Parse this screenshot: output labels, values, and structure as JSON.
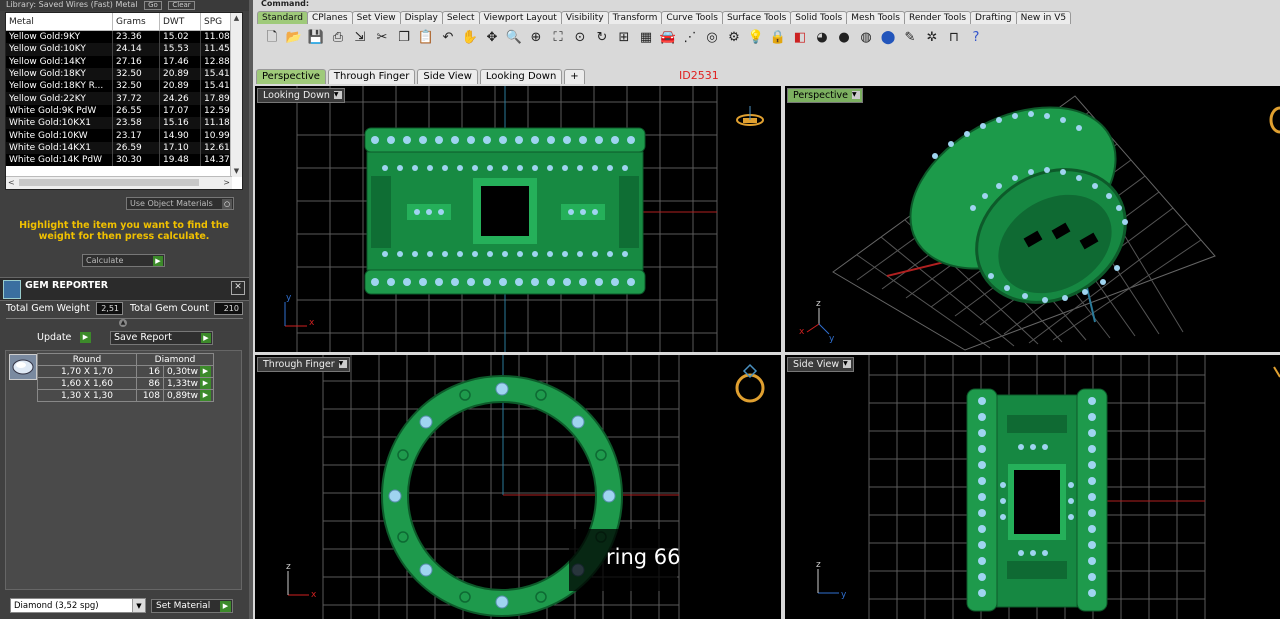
{
  "left_panel": {
    "top_strip": "Library: Saved Wires (Fast) Metal",
    "top_buttons": [
      "Go",
      "Clear"
    ],
    "metal_columns": [
      "Metal",
      "Grams",
      "DWT",
      "SPG"
    ],
    "metal_rows": [
      [
        "Yellow Gold:9KY",
        "23.36",
        "15.02",
        "11.08"
      ],
      [
        "Yellow Gold:10KY",
        "24.14",
        "15.53",
        "11.45"
      ],
      [
        "Yellow Gold:14KY",
        "27.16",
        "17.46",
        "12.88"
      ],
      [
        "Yellow Gold:18KY",
        "32.50",
        "20.89",
        "15.41"
      ],
      [
        "Yellow Gold:18KY R...",
        "32.50",
        "20.89",
        "15.41"
      ],
      [
        "Yellow Gold:22KY",
        "37.72",
        "24.26",
        "17.89"
      ],
      [
        "White Gold:9K PdW",
        "26.55",
        "17.07",
        "12.59"
      ],
      [
        "White Gold:10KX1",
        "23.58",
        "15.16",
        "11.18"
      ],
      [
        "White Gold:10KW",
        "23.17",
        "14.90",
        "10.99"
      ],
      [
        "White Gold:14KX1",
        "26.59",
        "17.10",
        "12.61"
      ],
      [
        "White Gold:14K PdW",
        "30.30",
        "19.48",
        "14.37"
      ]
    ],
    "use_object_materials": "Use Object Materials",
    "hint": "Highlight the item you want to find the weight for then press calculate.",
    "calculate_label": "Calculate"
  },
  "gem_reporter": {
    "title": "GEM REPORTER",
    "total_gem_weight_label": "Total Gem Weight",
    "total_gem_weight": "2,51",
    "total_gem_count_label": "Total Gem Count",
    "total_gem_count": "210",
    "update_label": "Update",
    "save_report_label": "Save Report",
    "columns": [
      "Round",
      "Diamond"
    ],
    "rows": [
      [
        "1,70 X 1,70",
        "16",
        "0,30tw"
      ],
      [
        "1,60 X 1,60",
        "86",
        "1,33tw"
      ],
      [
        "1,30 X 1,30",
        "108",
        "0,89tw"
      ]
    ],
    "material_select": "Diamond   (3,52 spg)",
    "set_material_label": "Set Material"
  },
  "command_label": "Command:",
  "toolbar_tabs": [
    "Standard",
    "CPlanes",
    "Set View",
    "Display",
    "Select",
    "Viewport Layout",
    "Visibility",
    "Transform",
    "Curve Tools",
    "Surface Tools",
    "Solid Tools",
    "Mesh Tools",
    "Render Tools",
    "Drafting",
    "New in V5"
  ],
  "viewport_tabs": [
    "Perspective",
    "Through Finger",
    "Side View",
    "Looking Down",
    "+"
  ],
  "id_label": "ID2531",
  "viewports": {
    "top_left": "Looking Down",
    "top_right": "Perspective",
    "bottom_left": "Through Finger",
    "bottom_right": "Side View"
  },
  "ring_label": "ring 66",
  "axis_labels": {
    "x": "x",
    "y": "y",
    "z": "z"
  },
  "colors": {
    "ring_green": "#1f9a4a",
    "gem_blue": "#9fd4f0",
    "viewport_bg": "#000000",
    "active_tab": "#9fca7a"
  }
}
